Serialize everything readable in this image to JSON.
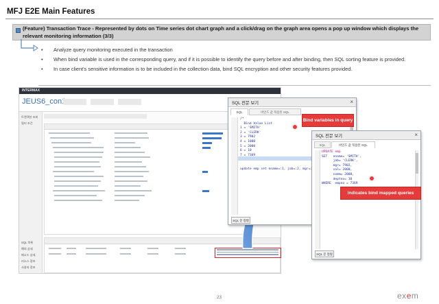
{
  "slide": {
    "title": "MFJ E2E Main Features",
    "feature_title": "(Feature) Transaction Trace - Represented by dots on Time series dot chart graph and a click/drag on the graph area opens a pop up window which displays the relevant monitoring information (3/3)",
    "bullet_symbol": "•",
    "bullets": [
      "Analyze query monitoring executed in the transaction",
      "When bind variable is used in the corresponding query, and if it is possible to identify the query before and after binding, then SQL sorting feature is provided.",
      "In case client's sensitive information is to be included in the collection data, bind SQL encryption and other security features provided."
    ],
    "page_number": "23",
    "brand": {
      "prefix": "ex",
      "accent": "e",
      "suffix": "m"
    }
  },
  "app": {
    "logo": "INTERMAX",
    "instance_name": "JEUS6_con1",
    "sidebar_items": [
      "트랜잭션 조회",
      "필터 조건"
    ],
    "bottom_sidebar_items": [
      "SQL 목록",
      "예외 상세",
      "메소드 상세",
      "리소스 정보",
      "사용자 정보"
    ]
  },
  "popup_left": {
    "title": "SQL 전문 보기",
    "tabs": [
      "SQL",
      "바인드 값 적용된 SQL"
    ],
    "code_lines": [
      "/*",
      "  Bind Value List",
      "1 = 'SMITH'",
      "2 = 'CLERK'",
      "3 = 7902",
      "4 = 1000",
      "5 = 2000",
      "6 = 10",
      "7 = 7369",
      "",
      "",
      "update emp set ename=:1, job=:2, mgr=:3,"
    ],
    "button": "SQL 문 정렬",
    "close": "×"
  },
  "popup_right": {
    "title": "SQL 전문 보기",
    "tabs": [
      "SQL",
      "바인드 값 적용된 SQL"
    ],
    "code_lines": [
      "UPDATE emp",
      "SET   ename= 'SMITH',",
      "      job= 'CLERK',",
      "      mgr= 7902,",
      "      sal= 2000,",
      "      comm= 2000,",
      "      deptno= 10",
      "WHERE  empno = 7369"
    ],
    "button": "SQL 문 정렬",
    "close": "×"
  },
  "callouts": {
    "bind_variables": "Bind variables in query",
    "bind_mapped": "Indicates bind mapped queries"
  },
  "colors": {
    "callout_red": "#e53b3b",
    "feature_box": "#d3d3d3",
    "accent_blue": "#3a76c4"
  }
}
